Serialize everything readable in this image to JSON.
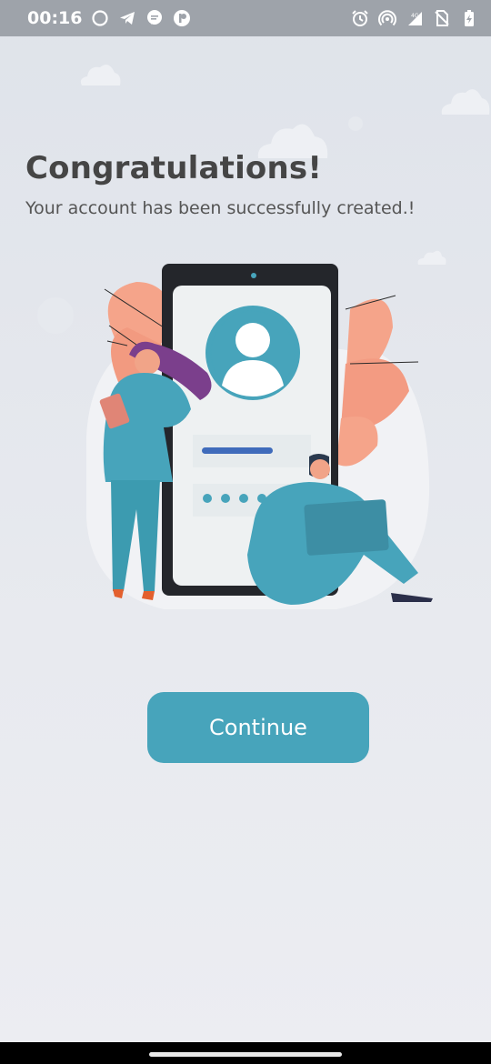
{
  "status_bar": {
    "time": "00:16",
    "left_icons": [
      "circle-icon",
      "telegram-icon",
      "message-icon",
      "notification-app-icon"
    ],
    "right_icons": [
      "alarm-icon",
      "hotspot-icon",
      "signal-4g-icon",
      "no-sim-icon",
      "battery-charging-icon"
    ]
  },
  "main": {
    "title": "Congratulations!",
    "subtitle": "Your account has been successfully created.!",
    "continue_label": "Continue"
  },
  "colors": {
    "accent": "#47a4bb",
    "title": "#454545",
    "text": "#555555",
    "leaves": "#f5a48a",
    "status_bar": "#9ea3aa"
  }
}
